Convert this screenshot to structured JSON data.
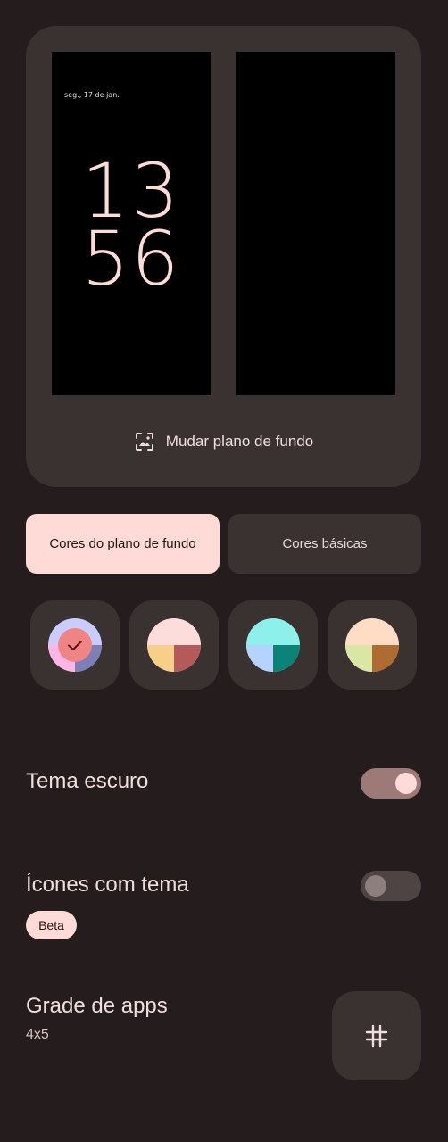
{
  "preview": {
    "lock_date": "seg., 17 de jan.",
    "clock_hours": "13",
    "clock_minutes": "56",
    "change_wallpaper_label": "Mudar plano de fundo",
    "change_wallpaper_icon": "wallpaper-icon"
  },
  "tabs": [
    {
      "label": "Cores do plano de fundo",
      "selected": true
    },
    {
      "label": "Cores básicas",
      "selected": false
    }
  ],
  "swatches": [
    {
      "selected": true,
      "colors": [
        "#c8ccff",
        "#ffb6e6",
        "#7d7fb9"
      ],
      "center": "#f08484",
      "check_icon": "check-icon"
    },
    {
      "selected": false,
      "colors": [
        "#fddcdc",
        "#f8cf88",
        "#b55a5a"
      ]
    },
    {
      "selected": false,
      "colors": [
        "#8ef0ea",
        "#b4d4ff",
        "#0b8377"
      ]
    },
    {
      "selected": false,
      "colors": [
        "#ffdcc4",
        "#d9e6a4",
        "#b06b32"
      ]
    }
  ],
  "settings": {
    "dark_theme": {
      "label": "Tema escuro",
      "enabled": true
    },
    "themed_icons": {
      "label": "Ícones com tema",
      "badge": "Beta",
      "enabled": false
    },
    "app_grid": {
      "label": "Grade de apps",
      "value": "4x5",
      "icon": "grid-icon"
    }
  },
  "colors": {
    "background": "#251d1d",
    "surface": "#3a3131",
    "accent": "#ffdbd7",
    "toggle_on_track": "#9d7a78"
  }
}
